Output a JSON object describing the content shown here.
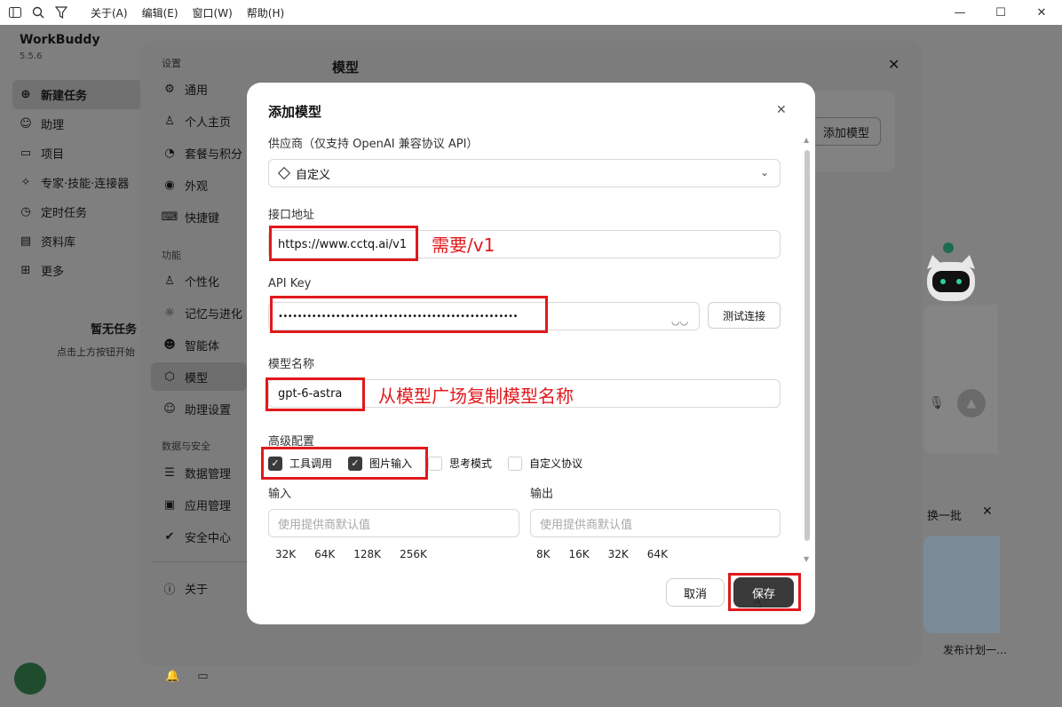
{
  "menu": [
    "关于(A)",
    "编辑(E)",
    "窗口(W)",
    "帮助(H)"
  ],
  "app": {
    "brand": "WorkBuddy",
    "version": "5.5.6",
    "nav": [
      "新建任务",
      "助理",
      "项目",
      "专家·技能·连接器",
      "定时任务",
      "资料库",
      "更多"
    ],
    "empty_title": "暂无任务",
    "empty_sub": "点击上方按钮开始",
    "refresh": "换一批",
    "plan_text": "发布计划一…"
  },
  "settings": {
    "section_label_1": "设置",
    "group1": [
      "通用",
      "个人主页",
      "套餐与积分",
      "外观",
      "快捷键"
    ],
    "section_label_2": "功能",
    "group2": [
      "个性化",
      "记忆与进化",
      "智能体",
      "模型",
      "助理设置"
    ],
    "section_label_3": "数据与安全",
    "group3": [
      "数据管理",
      "应用管理",
      "安全中心"
    ],
    "about": "关于",
    "title": "模型",
    "add_model": "添加模型"
  },
  "modal": {
    "title": "添加模型",
    "provider_label": "供应商（仅支持 OpenAI 兼容协议 API）",
    "provider_value": "自定义",
    "endpoint_label": "接口地址",
    "endpoint_value": "https://www.cctq.ai/v1",
    "apikey_label": "API Key",
    "apikey_value": "••••••••••••••••••••••••••••••••••••••••••••••••••",
    "test_label": "测试连接",
    "model_name_label": "模型名称",
    "model_name_value": "gpt-6-astra",
    "advanced_label": "高级配置",
    "checks": [
      {
        "label": "工具调用",
        "checked": true
      },
      {
        "label": "图片输入",
        "checked": true
      },
      {
        "label": "思考模式",
        "checked": false
      },
      {
        "label": "自定义协议",
        "checked": false
      }
    ],
    "input_label": "输入",
    "output_label": "输出",
    "input_placeholder": "使用提供商默认值",
    "output_placeholder": "使用提供商默认值",
    "input_chips": [
      "32K",
      "64K",
      "128K",
      "256K"
    ],
    "output_chips": [
      "8K",
      "16K",
      "32K",
      "64K"
    ],
    "cancel": "取消",
    "save": "保存"
  },
  "annotations": {
    "endpoint_note": "需要/v1",
    "model_note": "从模型广场复制模型名称"
  },
  "colors": {
    "annotation_red": "#e0191c",
    "primary_dark": "#3a3a3a"
  }
}
